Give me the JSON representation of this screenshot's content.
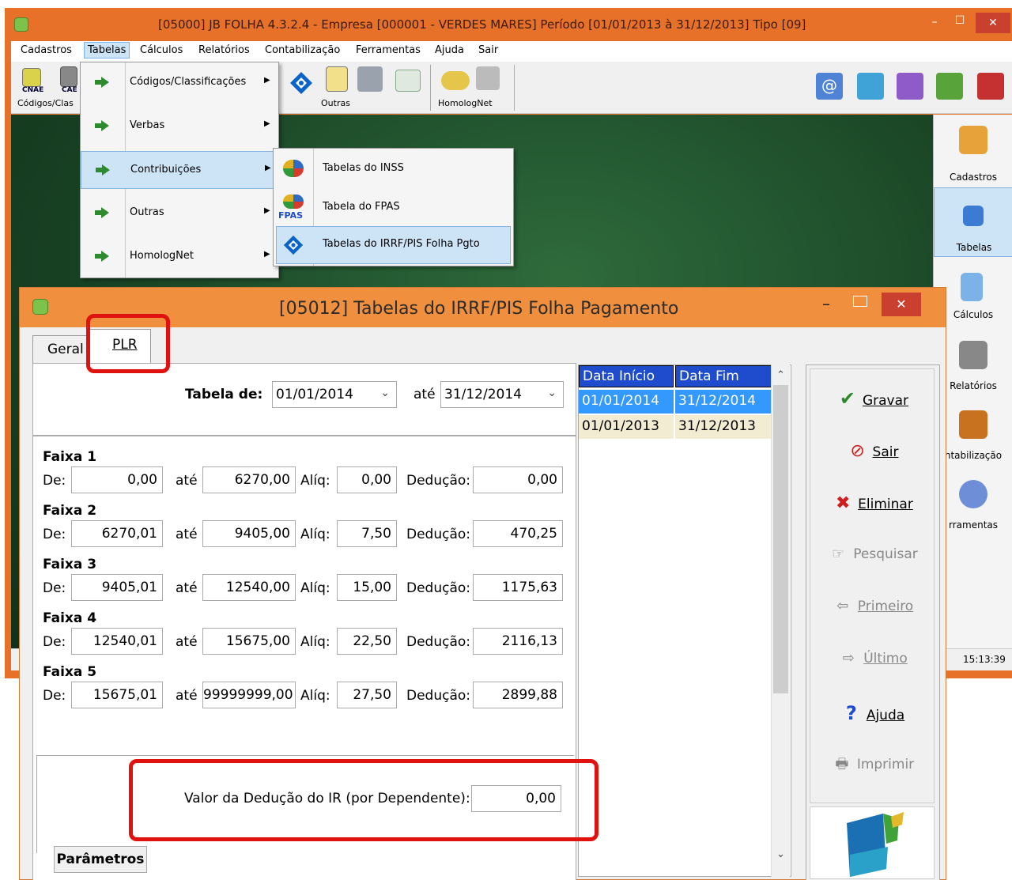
{
  "main_window": {
    "title": "[05000] JB FOLHA 4.3.2.4 - Empresa [000001 - VERDES MARES]  Período [01/01/2013 à 31/12/2013]  Tipo [09]",
    "minimize": "–",
    "maximize": "☐",
    "close": "✕"
  },
  "menubar": [
    "Cadastros",
    "Tabelas",
    "Cálculos",
    "Relatórios",
    "Contabilização",
    "Ferramentas",
    "Ajuda",
    "Sair"
  ],
  "toolbar": {
    "cnae": "CNAE",
    "cae": "CAE",
    "codigos": "Códigos/Clas",
    "outras": "Outras",
    "homolognet": "HomologNet"
  },
  "tabelas_menu": [
    "Códigos/Classificações",
    "Verbas",
    "Contribuições",
    "Outras",
    "HomologNet"
  ],
  "contribuicoes_menu": [
    "Tabelas do INSS",
    "Tabela do FPAS",
    "Tabelas do IRRF/PIS Folha Pgto"
  ],
  "fpas_icon_text": "FPAS",
  "right_panel": [
    "Cadastros",
    "Tabelas",
    "Cálculos",
    "Relatórios",
    "ntabilização",
    "rramentas"
  ],
  "status_time": "15:13:39",
  "dialog": {
    "title": "[05012] Tabelas do IRRF/PIS Folha Pagamento",
    "tabs": {
      "geral": "Geral",
      "plr": "PLR"
    },
    "tabela_de_label": "Tabela de:",
    "tabela_de": "01/01/2014",
    "ate_label": "até",
    "ate": "31/12/2014",
    "labels": {
      "de": "De:",
      "ate": "até",
      "aliq": "Alíq:",
      "deducao": "Dedução:"
    },
    "faixas": [
      {
        "name": "Faixa 1",
        "de": "0,00",
        "ate": "6270,00",
        "aliq": "0,00",
        "deducao": "0,00"
      },
      {
        "name": "Faixa 2",
        "de": "6270,01",
        "ate": "9405,00",
        "aliq": "7,50",
        "deducao": "470,25"
      },
      {
        "name": "Faixa 3",
        "de": "9405,01",
        "ate": "12540,00",
        "aliq": "15,00",
        "deducao": "1175,63"
      },
      {
        "name": "Faixa 4",
        "de": "12540,01",
        "ate": "15675,00",
        "aliq": "22,50",
        "deducao": "2116,13"
      },
      {
        "name": "Faixa 5",
        "de": "15675,01",
        "ate": "99999999,00",
        "aliq": "27,50",
        "deducao": "2899,88"
      }
    ],
    "valor_deducao_label": "Valor da Dedução do IR (por Dependente):",
    "valor_deducao": "0,00",
    "parametros_tab": "Parâmetros",
    "grid": {
      "headers": [
        "Data Início",
        "Data Fim"
      ],
      "rows": [
        [
          "01/01/2014",
          "31/12/2014"
        ],
        [
          "01/01/2013",
          "31/12/2013"
        ]
      ]
    },
    "buttons": {
      "gravar": "Gravar",
      "sair": "Sair",
      "eliminar": "Eliminar",
      "pesquisar": "Pesquisar",
      "primeiro": "Primeiro",
      "ultimo": "Último",
      "ajuda": "Ajuda",
      "imprimir": "Imprimir"
    }
  },
  "colors": {
    "title_orange": "#f0903f",
    "highlight_red": "#e0120f",
    "grid_header": "#1e4ccc",
    "grid_selected": "#3399ff"
  }
}
